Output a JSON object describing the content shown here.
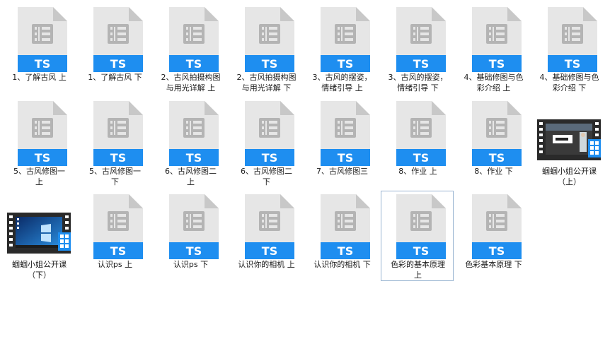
{
  "files": [
    {
      "label": "1、了解古风 上",
      "type": "TS"
    },
    {
      "label": "1、了解古风 下",
      "type": "TS"
    },
    {
      "label": "2、古风拍摄构图\n与用光详解  上",
      "type": "TS"
    },
    {
      "label": "2、古风拍摄构图\n与用光详解  下",
      "type": "TS"
    },
    {
      "label": "3、古风的摆姿，\n情绪引导  上",
      "type": "TS"
    },
    {
      "label": "3、古风的摆姿，\n情绪引导  下",
      "type": "TS"
    },
    {
      "label": "4、基础修图与色\n彩介绍  上",
      "type": "TS"
    },
    {
      "label": "4、基础修图与色\n彩介绍  下",
      "type": "TS"
    },
    {
      "label": "5、古风修图一\n上",
      "type": "TS"
    },
    {
      "label": "5、古风修图一\n下",
      "type": "TS"
    },
    {
      "label": "6、古风修图二\n上",
      "type": "TS"
    },
    {
      "label": "6、古风修图二\n下",
      "type": "TS"
    },
    {
      "label": "7、古风修图三",
      "type": "TS"
    },
    {
      "label": "8、作业 上",
      "type": "TS"
    },
    {
      "label": "8、作业 下",
      "type": "TS"
    },
    {
      "label": "蝈蝈小姐公开课\n（上）",
      "type": "video"
    },
    {
      "label": "蝈蝈小姐公开课\n（下）",
      "type": "video"
    },
    {
      "label": "认识ps 上",
      "type": "TS"
    },
    {
      "label": "认识ps 下",
      "type": "TS"
    },
    {
      "label": "认识你的相机 上",
      "type": "TS"
    },
    {
      "label": "认识你的相机 下",
      "type": "TS"
    },
    {
      "label": "色彩的基本原理\n上",
      "type": "TS",
      "selected": true
    },
    {
      "label": "色彩基本原理 下",
      "type": "TS"
    }
  ],
  "colors": {
    "doc_body": "#e6e6e6",
    "doc_fold": "#c8c8c8",
    "doc_glyph": "#b4b4b4",
    "ts_band": "#1e8ef0",
    "ts_text": "#ffffff",
    "selection_border": "#99b4d1"
  },
  "icons": {
    "ts_file": "ts-file-icon",
    "video_file": "video-thumbnail-icon"
  }
}
